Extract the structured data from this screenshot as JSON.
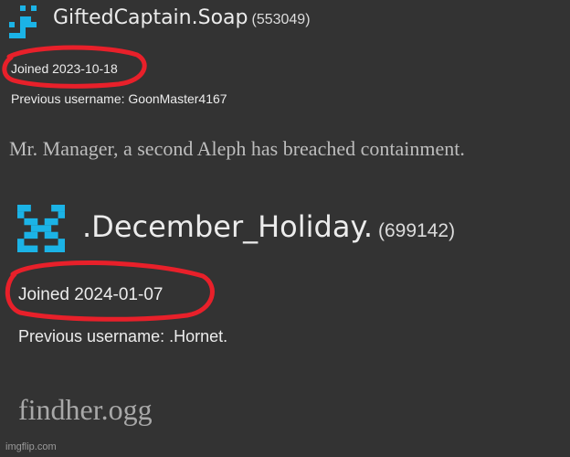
{
  "user1": {
    "display_name": "GiftedCaptain.Soap",
    "user_id": "(553049)",
    "joined": "Joined 2023-10-18",
    "previous_username": "Previous username: GoonMaster4167",
    "avatar_icon": "pixel-avatar-icon",
    "avatar_color": "#1bb3e6"
  },
  "caption1": "Mr. Manager, a second Aleph has breached containment.",
  "user2": {
    "display_name": ".December_Holiday.",
    "user_id": "(699142)",
    "joined": "Joined 2024-01-07",
    "previous_username": "Previous username: .Hornet.",
    "avatar_icon": "pixel-avatar-icon",
    "avatar_color": "#1bb3e6"
  },
  "caption2": "findher.ogg",
  "annotation_color": "#e8202a",
  "watermark": "imgflip.com"
}
